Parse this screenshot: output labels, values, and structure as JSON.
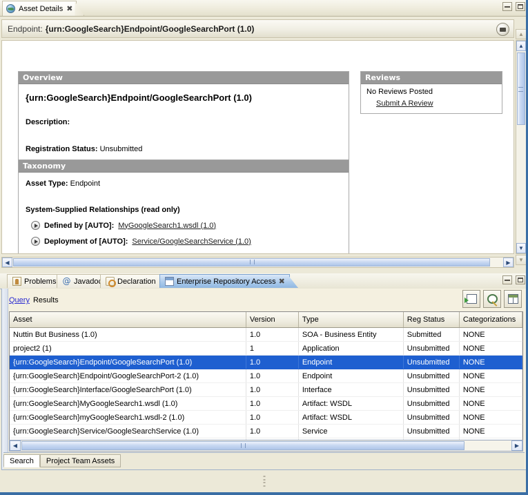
{
  "editor": {
    "tab": {
      "label": "Asset Details",
      "icon": "globe-icon",
      "close": "✖"
    },
    "window_controls": {
      "minimize": "minimize",
      "maximize": "maximize"
    },
    "header": {
      "prefix": "Endpoint:",
      "title": "{urn:GoogleSearch}Endpoint/GoogleSearchPort (1.0)",
      "form_icon": "form-icon"
    },
    "overview": {
      "heading": "Overview",
      "title": "{urn:GoogleSearch}Endpoint/GoogleSearchPort (1.0)",
      "description_label": "Description:",
      "description_value": "",
      "registration_label": "Registration Status:",
      "registration_value": "Unsubmitted"
    },
    "reviews": {
      "heading": "Reviews",
      "empty_text": "No Reviews Posted",
      "submit_link": "Submit A Review"
    },
    "taxonomy": {
      "heading": "Taxonomy",
      "asset_type_label": "Asset Type:",
      "asset_type_value": "Endpoint",
      "relationships_heading": "System-Supplied Relationships (read only)",
      "relationships": [
        {
          "label": "Defined by [AUTO]:",
          "link": "MyGoogleSearch1.wsdl (1.0)"
        },
        {
          "label": "Deployment of [AUTO]:",
          "link": "Service/GoogleSearchService (1.0)"
        }
      ]
    },
    "scroll": {
      "up_arrow": "▲",
      "down_arrow": "▼",
      "left_arrow": "◀",
      "right_arrow": "▶"
    }
  },
  "bottom_view": {
    "tabs": [
      {
        "label": "Problems",
        "icon": "problems-icon",
        "selected": false
      },
      {
        "label": "Javadoc",
        "icon": "javadoc-icon",
        "selected": false
      },
      {
        "label": "Declaration",
        "icon": "declaration-icon",
        "selected": false
      },
      {
        "label": "Enterprise Repository Access",
        "icon": "repository-icon",
        "selected": true,
        "close": "✖"
      }
    ],
    "window_controls": {
      "minimize": "minimize",
      "maximize": "maximize"
    },
    "query_bar": {
      "query_link": "Query",
      "results_label": "Results",
      "tools": [
        {
          "name": "submit-query-button",
          "icon": "form-arrow-icon"
        },
        {
          "name": "search-button",
          "icon": "magnifier-icon"
        },
        {
          "name": "table-view-button",
          "icon": "grid-icon"
        }
      ]
    },
    "table": {
      "columns": [
        "Asset",
        "Version",
        "Type",
        "Reg Status",
        "Categorizations"
      ],
      "rows": [
        {
          "asset": "Nuttin But Business (1.0)",
          "version": "1.0",
          "type": "SOA - Business Entity",
          "reg_status": "Submitted",
          "categorizations": "NONE",
          "selected": false
        },
        {
          "asset": "project2 (1)",
          "version": "1",
          "type": "Application",
          "reg_status": "Unsubmitted",
          "categorizations": "NONE",
          "selected": false
        },
        {
          "asset": "{urn:GoogleSearch}Endpoint/GoogleSearchPort (1.0)",
          "version": "1.0",
          "type": "Endpoint",
          "reg_status": "Unsubmitted",
          "categorizations": "NONE",
          "selected": true
        },
        {
          "asset": "{urn:GoogleSearch}Endpoint/GoogleSearchPort-2 (1.0)",
          "version": "1.0",
          "type": "Endpoint",
          "reg_status": "Unsubmitted",
          "categorizations": "NONE",
          "selected": false
        },
        {
          "asset": "{urn:GoogleSearch}Interface/GoogleSearchPort (1.0)",
          "version": "1.0",
          "type": "Interface",
          "reg_status": "Unsubmitted",
          "categorizations": "NONE",
          "selected": false
        },
        {
          "asset": "{urn:GoogleSearch}MyGoogleSearch1.wsdl (1.0)",
          "version": "1.0",
          "type": "Artifact: WSDL",
          "reg_status": "Unsubmitted",
          "categorizations": "NONE",
          "selected": false
        },
        {
          "asset": "{urn:GoogleSearch}myGoogleSearch1.wsdl-2 (1.0)",
          "version": "1.0",
          "type": "Artifact: WSDL",
          "reg_status": "Unsubmitted",
          "categorizations": "NONE",
          "selected": false
        },
        {
          "asset": "{urn:GoogleSearch}Service/GoogleSearchService (1.0)",
          "version": "1.0",
          "type": "Service",
          "reg_status": "Unsubmitted",
          "categorizations": "NONE",
          "selected": false
        }
      ]
    },
    "sub_tabs": [
      {
        "label": "Search",
        "selected": true
      },
      {
        "label": "Project Team Assets",
        "selected": false
      }
    ]
  },
  "colors": {
    "selection_blue": "#1e5fd0",
    "panel_header_gray": "#999999",
    "chrome_beige": "#ece9d8",
    "link_blue": "#2a2ad0",
    "active_tab_blue": "#a8c8ea"
  }
}
